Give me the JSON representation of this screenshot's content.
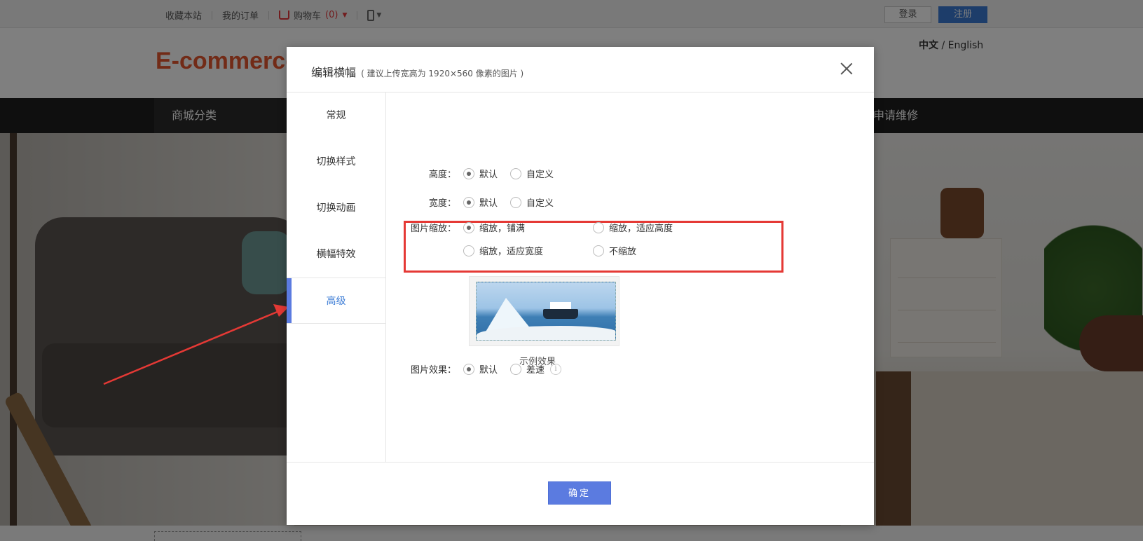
{
  "topbar": {
    "favorite": "收藏本站",
    "orders": "我的订单",
    "cart_label": "购物车",
    "cart_count": "(0)",
    "login": "登录",
    "register": "注册"
  },
  "header": {
    "logo": "E-commerce",
    "lang_cn": "中文",
    "lang_sep": " / ",
    "lang_en": "English"
  },
  "navbar": {
    "category": "商城分类",
    "repair": "申请维修"
  },
  "dialog": {
    "title": "编辑横幅",
    "hint": "( 建议上传宽高为 1920×560 像素的图片 )",
    "side_items": [
      "常规",
      "切换样式",
      "切换动画",
      "横幅特效",
      "高级"
    ],
    "active_item": "高级",
    "height": {
      "label": "高度：",
      "options": [
        "默认",
        "自定义"
      ],
      "selected": "默认"
    },
    "width": {
      "label": "宽度：",
      "options": [
        "默认",
        "自定义"
      ],
      "selected": "默认"
    },
    "scale": {
      "label": "图片缩放：",
      "options": [
        "缩放，铺满",
        "缩放，适应高度",
        "缩放，适应宽度",
        "不缩放"
      ],
      "selected": "缩放，铺满"
    },
    "preview_caption": "示例效果",
    "effect": {
      "label": "图片效果：",
      "options": [
        "默认",
        "差速"
      ],
      "selected": "默认",
      "info": "i"
    },
    "ok": "确定"
  },
  "colors": {
    "accent": "#5b7be0",
    "highlight": "#e53935",
    "logo": "#e4572e"
  }
}
